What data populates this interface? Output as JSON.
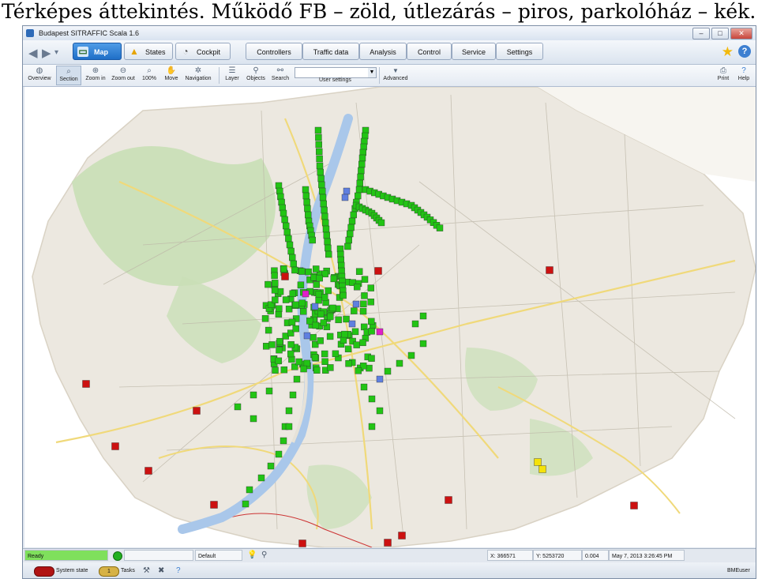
{
  "caption": "Térképes áttekintés. Működő FB – zöld, útlezárás – piros, parkolóház – kék.",
  "window": {
    "title": "Budapest SITRAFFIC Scala 1.6",
    "buttons": [
      "–",
      "□",
      "✕"
    ]
  },
  "nav": {
    "back": "◀",
    "forward": "▶",
    "history": "▾",
    "tabs": [
      {
        "label": "Map",
        "icon": "map-icon"
      },
      {
        "label": "States",
        "icon": "warning-icon"
      },
      {
        "label": "Cockpit",
        "icon": "gauge-icon"
      }
    ],
    "menus": [
      "Controllers",
      "Traffic data",
      "Analysis",
      "Control",
      "Service",
      "Settings"
    ]
  },
  "toolbar": {
    "tools": [
      {
        "label": "Overview",
        "icon": "globe-icon"
      },
      {
        "label": "Section",
        "icon": "section-zoom-icon"
      },
      {
        "label": "Zoom in",
        "icon": "zoom-in-icon"
      },
      {
        "label": "Zoom out",
        "icon": "zoom-out-icon"
      },
      {
        "label": "100%",
        "icon": "zoom-100-icon"
      },
      {
        "label": "Move",
        "icon": "hand-icon"
      },
      {
        "label": "Navigation",
        "icon": "navigation-icon"
      },
      {
        "label": "Layer",
        "icon": "layer-icon"
      },
      {
        "label": "Objects",
        "icon": "objects-icon"
      },
      {
        "label": "Search",
        "icon": "binoculars-icon"
      }
    ],
    "user_settings_label": "User settings",
    "user_settings_value": "",
    "advanced_label": "Advanced",
    "print_label": "Print",
    "help_label": "Help"
  },
  "map": {
    "colors": {
      "working": "#22c414",
      "closure": "#cc1111",
      "parking": "#5f7fe0",
      "special": "#e020c8",
      "warning": "#f4e20a"
    }
  },
  "status": {
    "ready": "Ready",
    "layer": "Default",
    "x": "X: 366571",
    "y": "Y: 5253720",
    "scale": "0.004",
    "datetime": "May 7, 2013 3:26:45 PM"
  },
  "bottom": {
    "system_state_label": "System state",
    "tasks_label": "Tasks",
    "tasks_count": "1",
    "user": "BMEuser"
  }
}
